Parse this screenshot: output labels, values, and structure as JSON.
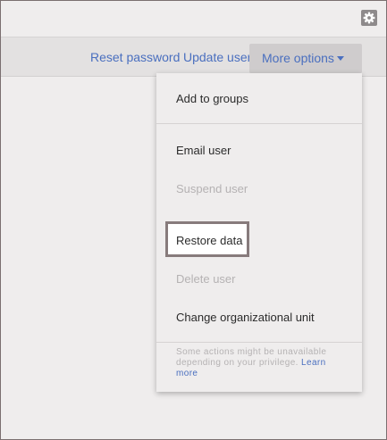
{
  "toolbar": {
    "settings_icon": "gear-icon"
  },
  "actions": {
    "reset_password": "Reset password",
    "update_user": "Update user",
    "more_options": "More options",
    "more_options_icon": "caret-down-icon"
  },
  "menu": {
    "items": [
      {
        "label": "Add to groups",
        "enabled": true
      },
      {
        "label": "Email user",
        "enabled": true
      },
      {
        "label": "Suspend user",
        "enabled": false
      },
      {
        "label": "Restore data",
        "enabled": true,
        "highlighted": true
      },
      {
        "label": "Delete user",
        "enabled": false
      },
      {
        "label": "Change organizational unit",
        "enabled": true
      }
    ],
    "footer_note": "Some actions might be unavailable depending on your privilege.",
    "learn_more": "Learn more"
  },
  "colors": {
    "link": "#4a6fbf",
    "disabled_text": "#b5b2b3",
    "background": "#efeded",
    "highlight_border": "#877b7c"
  }
}
